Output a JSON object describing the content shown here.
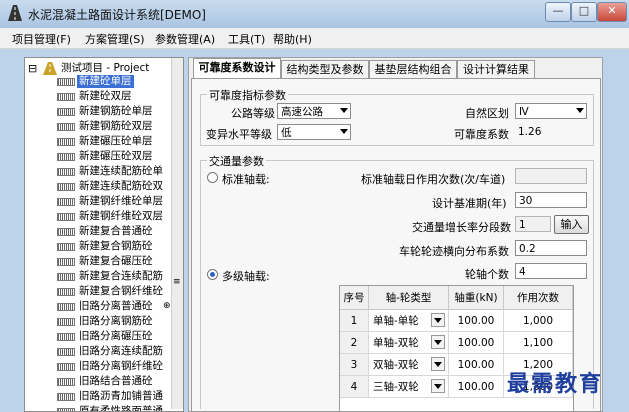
{
  "window": {
    "title": "水泥混凝土路面设计系统[DEMO]",
    "accent": "#a9c4e2"
  },
  "window_controls": {
    "minimize": "—",
    "maximize": "□",
    "close": "✕"
  },
  "menu": [
    "项目管理(F)",
    "方案管理(S)",
    "参数管理(A)",
    "工具(T)",
    "帮助(H)"
  ],
  "tree": {
    "expander": "⊟",
    "root": "测试项目 - Project",
    "items": [
      "新建砼单层",
      "新建砼双层",
      "新建钢筋砼单层",
      "新建钢筋砼双层",
      "新建碾压砼单层",
      "新建碾压砼双层",
      "新建连续配筋砼单",
      "新建连续配筋砼双",
      "新建钢纤维砼单层",
      "新建钢纤维砼双层",
      "新建复合普通砼",
      "新建复合钢筋砼",
      "新建复合碾压砼",
      "新建复合连续配筋",
      "新建复合钢纤维砼",
      "旧路分离普通砼",
      "旧路分离钢筋砼",
      "旧路分离碾压砼",
      "旧路分离连续配筋",
      "旧路分离钢纤维砼",
      "旧路结合普通砼",
      "旧路沥青加铺普通",
      "原有柔性路面普通"
    ],
    "selected_index": 0,
    "selected_color": "#3b6fd4",
    "extra_glyph": "⊕",
    "scroll_glyph": "≡"
  },
  "tabs": [
    "可靠度系数设计",
    "结构类型及参数",
    "基垫层结构组合",
    "设计计算结果"
  ],
  "active_tab": 0,
  "reliability": {
    "section_title": "可靠度指标参数",
    "road_grade_label": "公路等级",
    "road_grade_value": "高速公路",
    "variation_label": "变异水平等级",
    "variation_value": "低",
    "natural_zone_label": "自然区划",
    "natural_zone_value": "Ⅳ",
    "reliability_coef_label": "可靠度系数",
    "reliability_coef_value": "1.26"
  },
  "traffic": {
    "section_title": "交通量参数",
    "standard_axle_label": "标准轴载:",
    "daily_load_label": "标准轴载日作用次数(次/车道)",
    "daily_load_value": "",
    "design_period_label": "设计基准期(年)",
    "design_period_value": "30",
    "growth_label": "交通量增长率分段数",
    "growth_value": "1",
    "input_button": "输入",
    "lateral_label": "车轮轮迹横向分布系数",
    "lateral_value": "0.2",
    "multi_axle_label": "多级轴载:",
    "axle_count_label": "轮轴个数",
    "axle_count_value": "4",
    "selected_mode": "multi"
  },
  "axle_table": {
    "headers": [
      "序号",
      "轴-轮类型",
      "轴重(kN)",
      "作用次数"
    ],
    "rows": [
      {
        "idx": "1",
        "type": "单轴-单轮",
        "weight": "100.00",
        "count": "1,000"
      },
      {
        "idx": "2",
        "type": "单轴-双轮",
        "weight": "100.00",
        "count": "1,100"
      },
      {
        "idx": "3",
        "type": "双轴-双轮",
        "weight": "100.00",
        "count": "1,200"
      },
      {
        "idx": "4",
        "type": "三轴-双轮",
        "weight": "100.00",
        "count": "1,300"
      }
    ]
  },
  "watermark": "最需教育"
}
